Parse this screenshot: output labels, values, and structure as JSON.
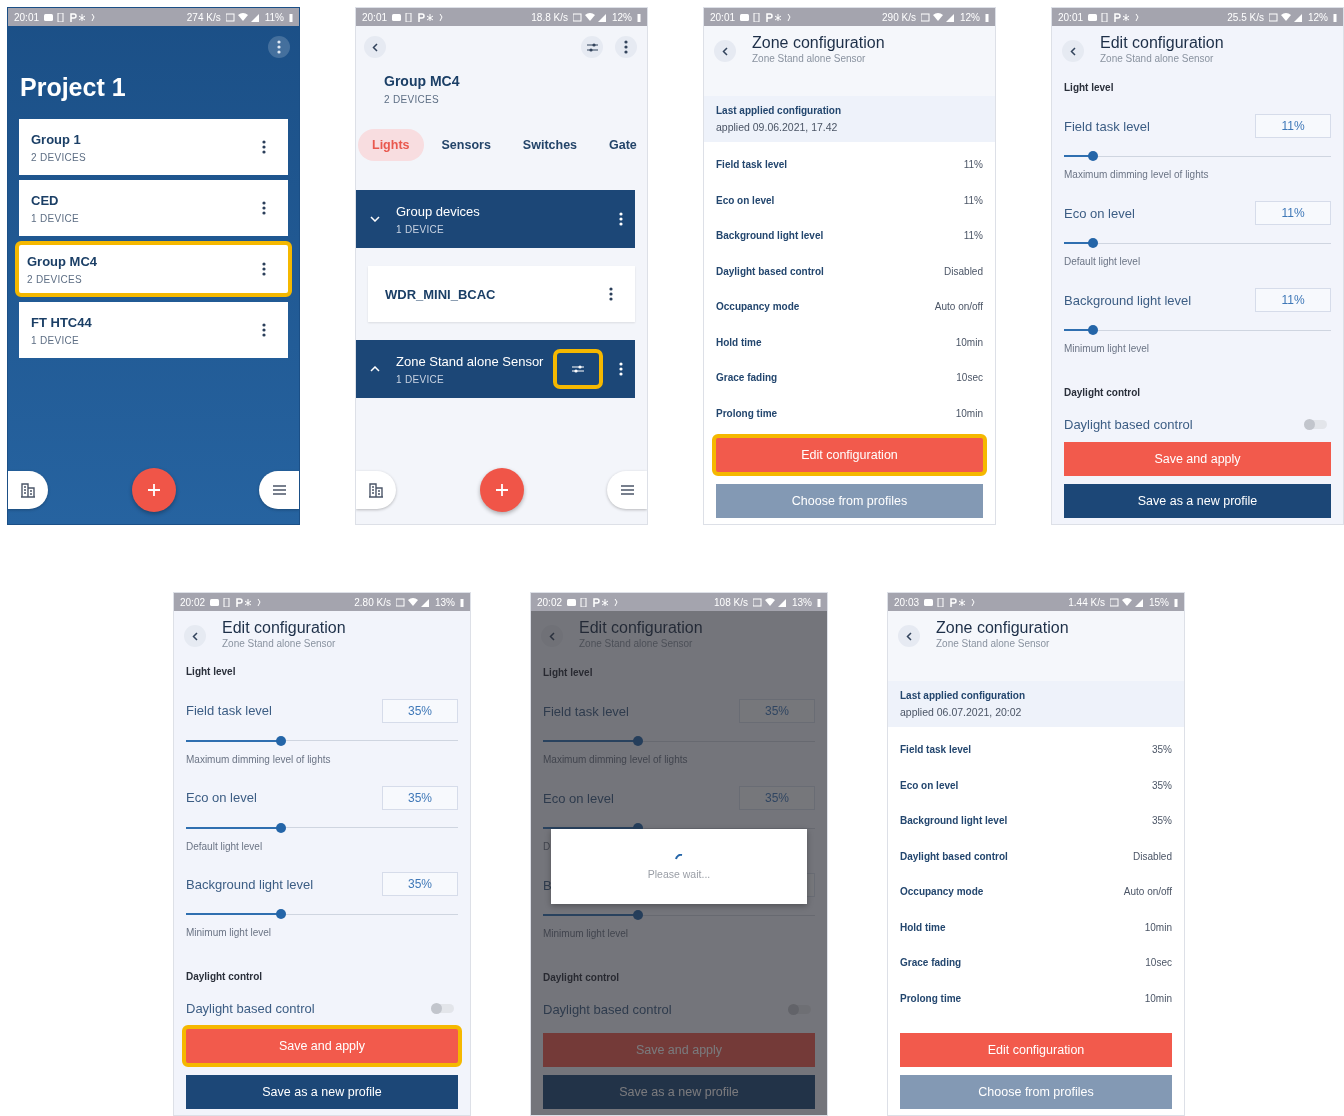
{
  "screens": [
    {
      "kind": "project",
      "status": {
        "time": "20:01",
        "speed": "274 K/s",
        "battery": "11%"
      },
      "title": "Project 1",
      "cards": [
        {
          "name": "Group 1",
          "count": "2 DEVICES",
          "highlighted": false
        },
        {
          "name": "CED",
          "count": "1 DEVICE",
          "highlighted": false
        },
        {
          "name": "Group MC4",
          "count": "2 DEVICES",
          "highlighted": true
        },
        {
          "name": "FT HTC44",
          "count": "1 DEVICE",
          "highlighted": false
        }
      ]
    },
    {
      "kind": "group",
      "status": {
        "time": "20:01",
        "speed": "18.8 K/s",
        "battery": "12%"
      },
      "title": "Group MC4",
      "subtitle": "2 DEVICES",
      "tabs": [
        {
          "label": "Lights",
          "selected": true
        },
        {
          "label": "Sensors",
          "selected": false
        },
        {
          "label": "Switches",
          "selected": false
        },
        {
          "label": "Gate",
          "selected": false
        }
      ],
      "sections": [
        {
          "name": "Group devices",
          "count": "1 DEVICE",
          "expanded": true,
          "devices": [
            {
              "name": "WDR_MINI_BCAC"
            }
          ]
        },
        {
          "name": "Zone Stand alone Sensor",
          "count": "1 DEVICE",
          "expanded": false,
          "config": {
            "highlighted": true
          }
        }
      ]
    },
    {
      "kind": "zone",
      "status": {
        "time": "20:01",
        "speed": "290 K/s",
        "battery": "12%"
      },
      "title": "Zone configuration",
      "subtitle": "Zone Stand alone Sensor",
      "last_applied": {
        "title": "Last applied configuration",
        "date": "applied 09.06.2021, 17.42"
      },
      "rows": [
        {
          "label": "Field task level",
          "value": "11%"
        },
        {
          "label": "Eco on level",
          "value": "11%"
        },
        {
          "label": "Background light level",
          "value": "11%"
        },
        {
          "label": "Daylight based control",
          "value": "Disabled"
        },
        {
          "label": "Occupancy mode",
          "value": "Auto on/off"
        },
        {
          "label": "Hold time",
          "value": "10min"
        },
        {
          "label": "Grace fading",
          "value": "10sec"
        },
        {
          "label": "Prolong time",
          "value": "10min"
        }
      ],
      "buttons": [
        {
          "label": "Edit configuration",
          "kind": "primary",
          "disabled": false,
          "highlighted": true
        },
        {
          "label": "Choose from profiles",
          "kind": "secondary",
          "disabled": true,
          "highlighted": false
        }
      ]
    },
    {
      "kind": "edit",
      "status": {
        "time": "20:01",
        "speed": "25.5 K/s",
        "battery": "12%"
      },
      "title": "Edit configuration",
      "subtitle": "Zone Stand alone Sensor",
      "light_title": "Light level",
      "levels": [
        {
          "label": "Field task level",
          "value": "11%",
          "level": 0.11,
          "description": "Maximum dimming level of lights"
        },
        {
          "label": "Eco on level",
          "value": "11%",
          "level": 0.11,
          "description": "Default light level"
        },
        {
          "label": "Background light level",
          "value": "11%",
          "level": 0.11,
          "description": "Minimum light level"
        }
      ],
      "daylight_title": "Daylight control",
      "toggle": {
        "label": "Daylight based control",
        "on": false
      },
      "buttons": [
        {
          "label": "Save and apply",
          "kind": "primary",
          "disabled": false,
          "highlighted": false
        },
        {
          "label": "Save as a new profile",
          "kind": "secondary",
          "disabled": false,
          "highlighted": false
        }
      ]
    },
    {
      "kind": "edit",
      "status": {
        "time": "20:02",
        "speed": "2.80 K/s",
        "battery": "13%"
      },
      "title": "Edit configuration",
      "subtitle": "Zone Stand alone Sensor",
      "light_title": "Light level",
      "levels": [
        {
          "label": "Field task level",
          "value": "35%",
          "level": 0.35,
          "description": "Maximum dimming level of lights"
        },
        {
          "label": "Eco on level",
          "value": "35%",
          "level": 0.35,
          "description": "Default light level"
        },
        {
          "label": "Background light level",
          "value": "35%",
          "level": 0.35,
          "description": "Minimum light level"
        }
      ],
      "daylight_title": "Daylight control",
      "toggle": {
        "label": "Daylight based control",
        "on": false
      },
      "buttons": [
        {
          "label": "Save and apply",
          "kind": "primary",
          "disabled": false,
          "highlighted": true
        },
        {
          "label": "Save as a new profile",
          "kind": "secondary",
          "disabled": false,
          "highlighted": false
        }
      ]
    },
    {
      "kind": "edit",
      "status": {
        "time": "20:02",
        "speed": "108 K/s",
        "battery": "13%"
      },
      "title": "Edit configuration",
      "subtitle": "Zone Stand alone Sensor",
      "light_title": "Light level",
      "levels": [
        {
          "label": "Field task level",
          "value": "35%",
          "level": 0.35,
          "description": "Maximum dimming level of lights"
        },
        {
          "label": "Eco on level",
          "value": "35%",
          "level": 0.35,
          "description": "D"
        },
        {
          "label": "B",
          "level": 0.35,
          "description": "Minimum light level"
        }
      ],
      "daylight_title": "Daylight control",
      "toggle": {
        "label": "Daylight based control",
        "on": false
      },
      "buttons": [
        {
          "label": "Save and apply",
          "kind": "primary",
          "disabled": false,
          "highlighted": false
        },
        {
          "label": "Save as a new profile",
          "kind": "secondary",
          "disabled": false,
          "highlighted": false
        }
      ],
      "busy": {
        "message": "Please wait..."
      }
    },
    {
      "kind": "zone",
      "status": {
        "time": "20:03",
        "speed": "1.44 K/s",
        "battery": "15%"
      },
      "title": "Zone configuration",
      "subtitle": "Zone Stand alone Sensor",
      "last_applied": {
        "title": "Last applied configuration",
        "date": "applied 06.07.2021, 20:02"
      },
      "rows": [
        {
          "label": "Field task level",
          "value": "35%"
        },
        {
          "label": "Eco on level",
          "value": "35%"
        },
        {
          "label": "Background light level",
          "value": "35%"
        },
        {
          "label": "Daylight based control",
          "value": "Disabled"
        },
        {
          "label": "Occupancy mode",
          "value": "Auto on/off"
        },
        {
          "label": "Hold time",
          "value": "10min"
        },
        {
          "label": "Grace fading",
          "value": "10sec"
        },
        {
          "label": "Prolong time",
          "value": "10min"
        }
      ],
      "buttons": [
        {
          "label": "Edit configuration",
          "kind": "primary",
          "disabled": false,
          "highlighted": false
        },
        {
          "label": "Choose from profiles",
          "kind": "secondary",
          "disabled": true,
          "highlighted": false
        }
      ]
    }
  ]
}
